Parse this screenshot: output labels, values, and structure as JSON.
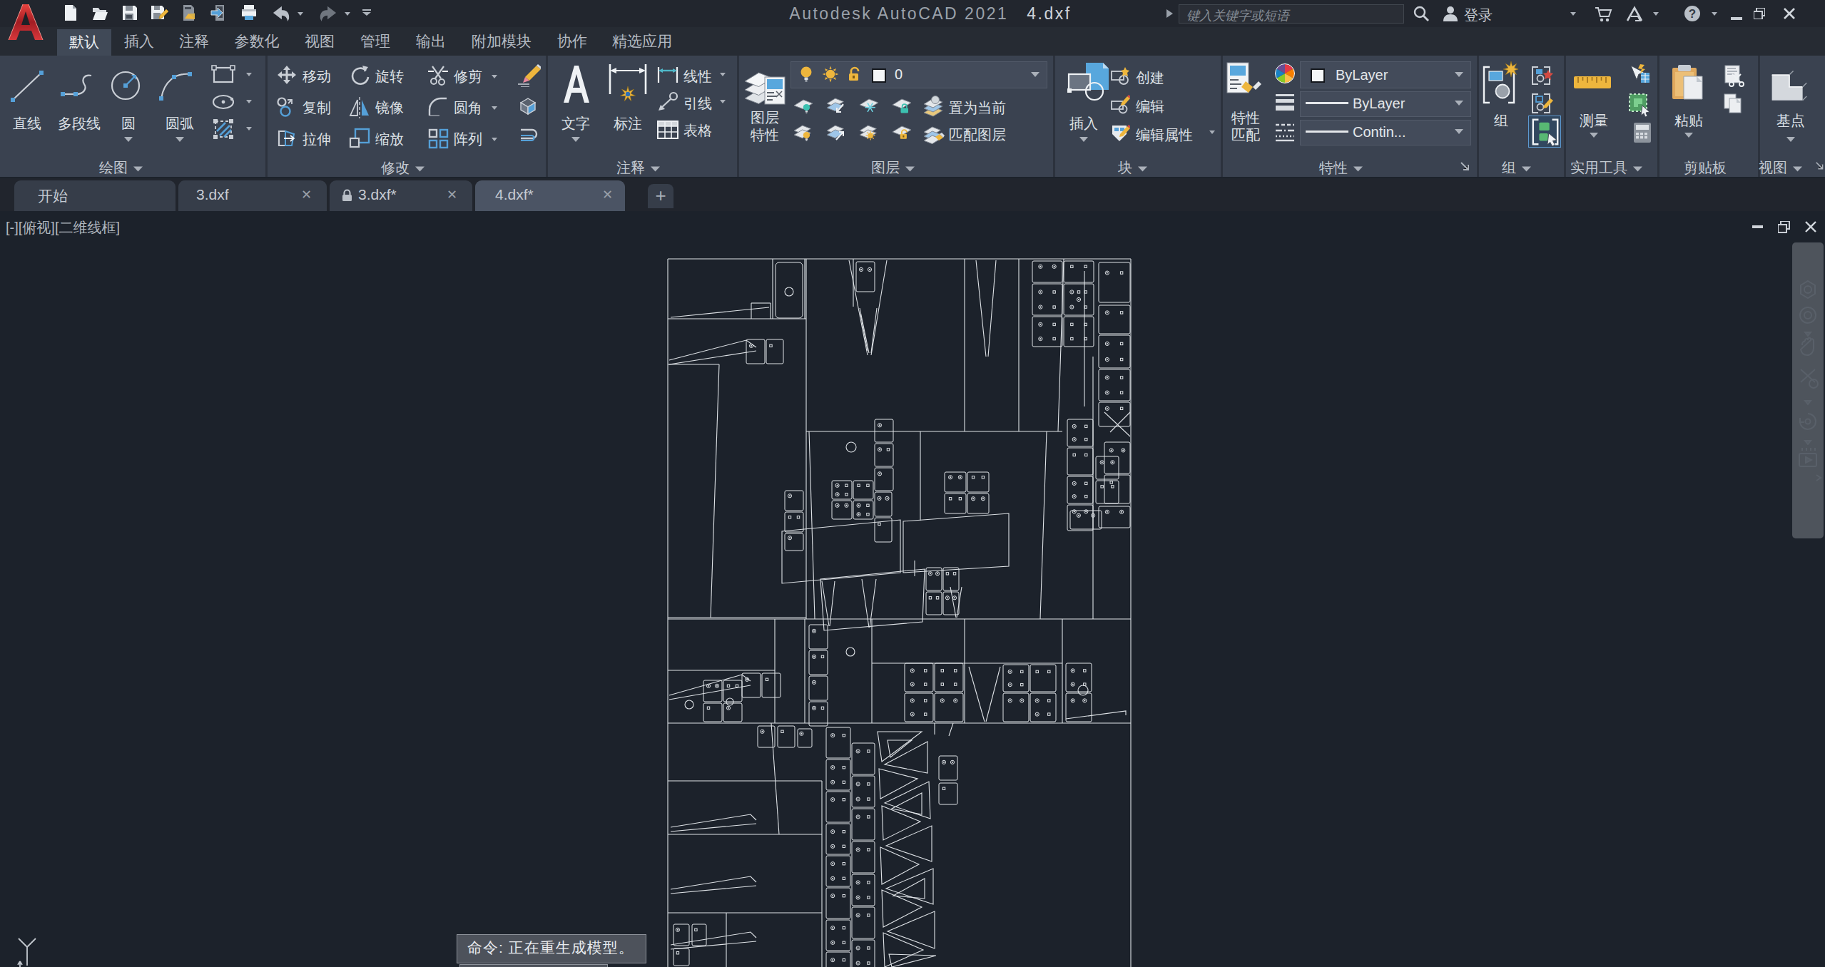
{
  "titlebar": {
    "app_title": "Autodesk AutoCAD 2021",
    "doc_title": "4.dxf",
    "search_placeholder": "键入关键字或短语",
    "signin_label": "登录"
  },
  "ribbon": {
    "tabs": [
      {
        "label": "默认"
      },
      {
        "label": "插入"
      },
      {
        "label": "注释"
      },
      {
        "label": "参数化"
      },
      {
        "label": "视图"
      },
      {
        "label": "管理"
      },
      {
        "label": "输出"
      },
      {
        "label": "附加模块"
      },
      {
        "label": "协作"
      },
      {
        "label": "精选应用"
      }
    ],
    "draw": {
      "label": "绘图",
      "line": "直线",
      "polyline": "多段线",
      "circle": "圆",
      "arc": "圆弧"
    },
    "modify": {
      "label": "修改",
      "move": "移动",
      "rotate": "旋转",
      "trim": "修剪",
      "copy": "复制",
      "mirror": "镜像",
      "fillet": "圆角",
      "stretch": "拉伸",
      "scale": "缩放",
      "array": "阵列"
    },
    "annotate": {
      "label": "注释",
      "text": "文字",
      "dim": "标注",
      "linear": "线性",
      "leader": "引线",
      "table": "表格"
    },
    "layers": {
      "label": "图层",
      "props_line1": "图层",
      "props_line2": "特性",
      "current_layer": "0",
      "set_current": "置为当前",
      "match_layer": "匹配图层"
    },
    "block": {
      "label": "块",
      "insert": "插入",
      "create": "创建",
      "edit": "编辑",
      "edit_attr": "编辑属性"
    },
    "properties": {
      "label": "特性",
      "match_line1": "特性",
      "match_line2": "匹配",
      "color_value": "ByLayer",
      "lineweight_value": "ByLayer",
      "linetype_value": "Contin..."
    },
    "group": {
      "label": "组",
      "group": "组"
    },
    "utilities": {
      "label": "实用工具",
      "measure": "测量"
    },
    "clipboard": {
      "label": "剪贴板",
      "paste": "粘贴"
    },
    "view": {
      "label": "视图",
      "base": "基点"
    }
  },
  "filetabs": {
    "start": "开始",
    "tab1": "3.dxf",
    "tab2": "3.dxf*",
    "tab3": "4.dxf*"
  },
  "canvas": {
    "viewport_label": "[-][俯视][二维线框]",
    "command_line": "命令: 正在重生成模型。",
    "command_line2": "正在重生成模型。"
  },
  "colors": {
    "ribbon_bg": "#3a4250",
    "titlebar_bg": "#22262e",
    "canvas_bg": "#1c222b",
    "drawing_line": "#dfe3e7",
    "accent_blue": "#58a6dc",
    "accent_yellow": "#eeb63d",
    "logo_red": "#c9252c"
  }
}
